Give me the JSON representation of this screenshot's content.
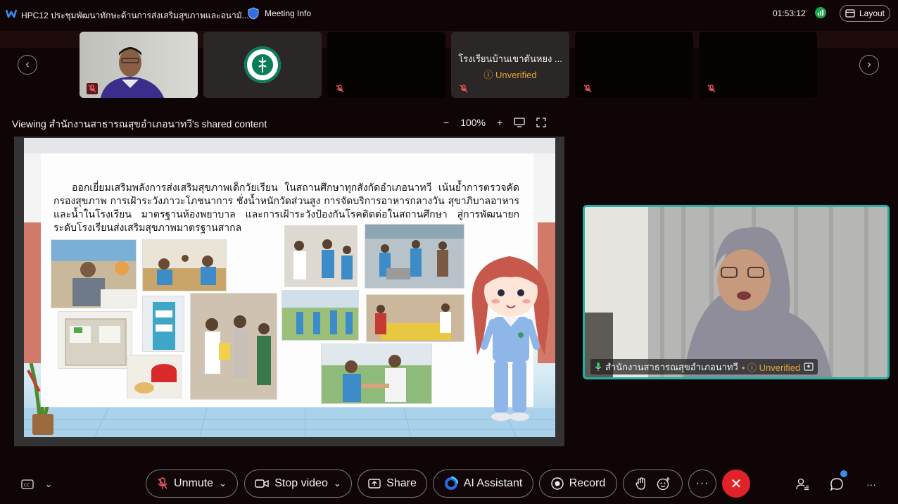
{
  "window": {
    "meeting_title": "HPC12 ประชุมพัฒนาทักษะด้านการส่งเสริมสุขภาพและอนามั...",
    "meeting_info_label": "Meeting Info",
    "timer": "01:53:12",
    "layout_label": "Layout"
  },
  "participants_strip": {
    "tiles": [
      {
        "name": "",
        "status": ""
      },
      {
        "name": "",
        "status": ""
      },
      {
        "name": "",
        "status": ""
      },
      {
        "name": "โรงเรียนบ้านเขาตันหยง ...",
        "status": "Unverified"
      },
      {
        "name": "",
        "status": ""
      },
      {
        "name": "",
        "status": ""
      }
    ]
  },
  "share_header": {
    "viewing_text": "Viewing สำนักงานสาธารณสุขอำเภอนาทวี's shared content",
    "zoom_level": "100%"
  },
  "slide": {
    "body_text": "ออกเยี่ยมเสริมพลังการส่งเสริมสุขภาพเด็กวัยเรียน ในสถานศึกษาทุกสังกัดอำเภอนาทวี เน้นย้ำการตรวจคัดกรองสุขภาพ การเฝ้าระวังภาวะโภชนาการ ชั่งน้ำหนักวัดส่วนสูง การจัดบริการอาหารกลางวัน สุขาภิบาลอาหารและน้ำในโรงเรียน มาตรฐานห้องพยาบาล และการเฝ้าระวังป้องกันโรคติดต่อในสถานศึกษา สู่การพัฒนายกระดับโรงเรียนส่งเสริมสุขภาพมาตรฐานสากล"
  },
  "speaker": {
    "name": "สำนักงานสาธารณสุขอำเภอนาทวี",
    "status": "Unverified"
  },
  "controls": {
    "unmute": "Unmute",
    "stop_video": "Stop video",
    "share": "Share",
    "ai_assistant": "AI Assistant",
    "record": "Record"
  },
  "colors": {
    "accent": "#27b0a0",
    "end_call": "#e0222a",
    "warning": "#e0a436"
  }
}
